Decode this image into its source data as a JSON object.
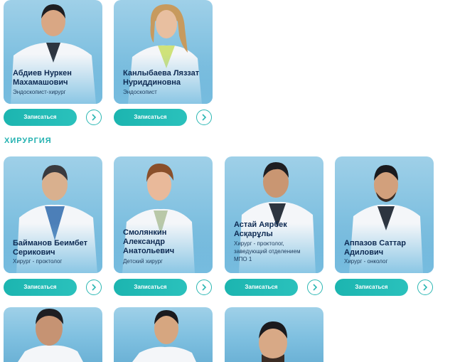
{
  "sections": [
    {
      "title": "ХИРУРГИЯ"
    }
  ],
  "doctors": [
    {
      "name": "Абдиев Нуркен Махамашович",
      "name_l1": "Абдиев Нуркен",
      "name_l2": "Махамашович",
      "role": "Эндоскопист-хирург"
    },
    {
      "name": "Канлыбаева Ляззат Нуриддиновна",
      "name_l1": "Канлыбаева Ляззат",
      "name_l2": "Нуриддиновна",
      "role": "Эндоскопист"
    },
    {
      "name_l1": "Байманов Беимбет",
      "name_l2": "Серикович",
      "role": "Хирург - проктолог"
    },
    {
      "name_l1": "Смолянкин",
      "name_l2": "Александр",
      "name_l3": "Анатольевич",
      "role": "Детский хирург"
    },
    {
      "name_l1": "Астай Аярбек",
      "name_l2": "Асқарұлы",
      "role_l1": "Хирург - проктолог,",
      "role_l2": "заведующий отделением",
      "role_l3": "МПО 1"
    },
    {
      "name_l1": "Аппазов Саттар",
      "name_l2": "Адилович",
      "role": "Хирург - онколог"
    }
  ],
  "buttons": {
    "book_label": "Записаться"
  },
  "colors": {
    "accent": "#22b1b0",
    "button": "#1cb5b0",
    "name": "#0d2a52",
    "card": "#8cc8e4"
  },
  "icons": {
    "arrow": "chevron-right-icon"
  }
}
